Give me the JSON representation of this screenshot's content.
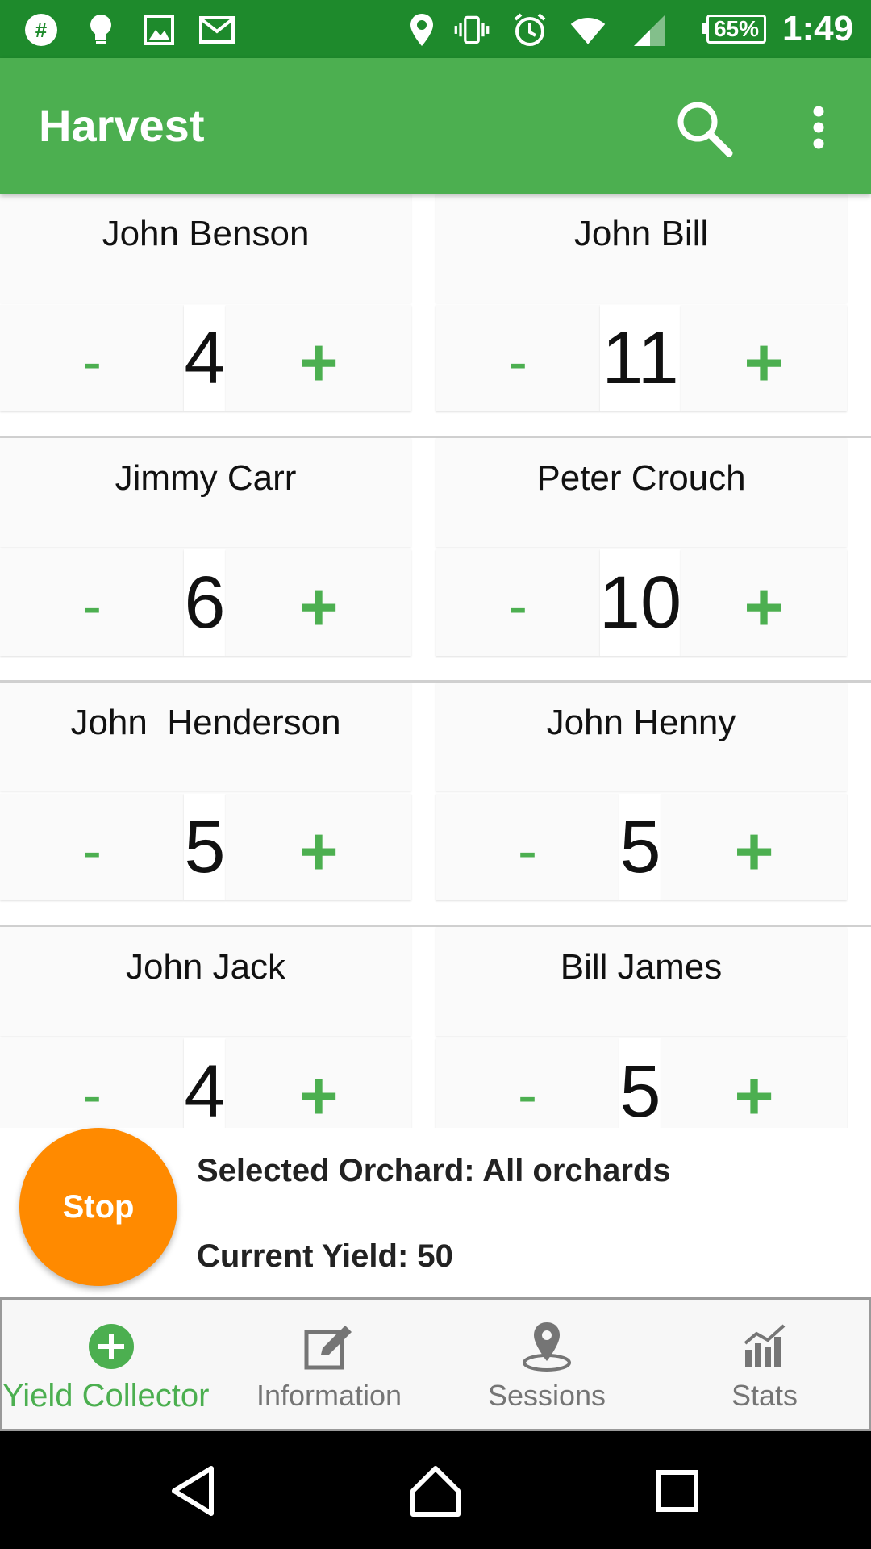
{
  "status_bar": {
    "battery": "65%",
    "time": "1:49",
    "left_icons": [
      "slack-icon",
      "lightbulb-icon",
      "image-icon",
      "gmail-icon"
    ],
    "right_icons": [
      "location-icon",
      "vibrate-icon",
      "alarm-icon",
      "wifi-icon",
      "cell-signal-icon",
      "battery-icon"
    ]
  },
  "app_bar": {
    "title": "Harvest",
    "actions": [
      "search-icon",
      "more-vert-icon"
    ]
  },
  "pickers": [
    {
      "name": "John Benson",
      "count": "4"
    },
    {
      "name": "John Bill",
      "count": "11"
    },
    {
      "name": "Jimmy Carr",
      "count": "6"
    },
    {
      "name": "Peter Crouch",
      "count": "10"
    },
    {
      "name": "John  Henderson",
      "count": "5"
    },
    {
      "name": "John Henny",
      "count": "5"
    },
    {
      "name": "John Jack",
      "count": "4"
    },
    {
      "name": "Bill James",
      "count": "5"
    }
  ],
  "controls": {
    "minus": "-",
    "plus": "+"
  },
  "info": {
    "stop_label": "Stop",
    "selected_orchard": "Selected Orchard: All orchards",
    "current_yield": "Current Yield: 50"
  },
  "bottom_nav": {
    "items": [
      {
        "label": "Yield Collector",
        "icon": "add-circle-icon",
        "active": true
      },
      {
        "label": "Information",
        "icon": "edit-note-icon",
        "active": false
      },
      {
        "label": "Sessions",
        "icon": "place-icon",
        "active": false
      },
      {
        "label": "Stats",
        "icon": "bar-chart-icon",
        "active": false
      }
    ]
  },
  "system_nav": [
    "back-icon",
    "home-icon",
    "recents-icon"
  ],
  "colors": {
    "status_bar": "#1e8a2c",
    "primary": "#4caf50",
    "accent": "#ff8a00",
    "inactive_nav": "#757575"
  }
}
